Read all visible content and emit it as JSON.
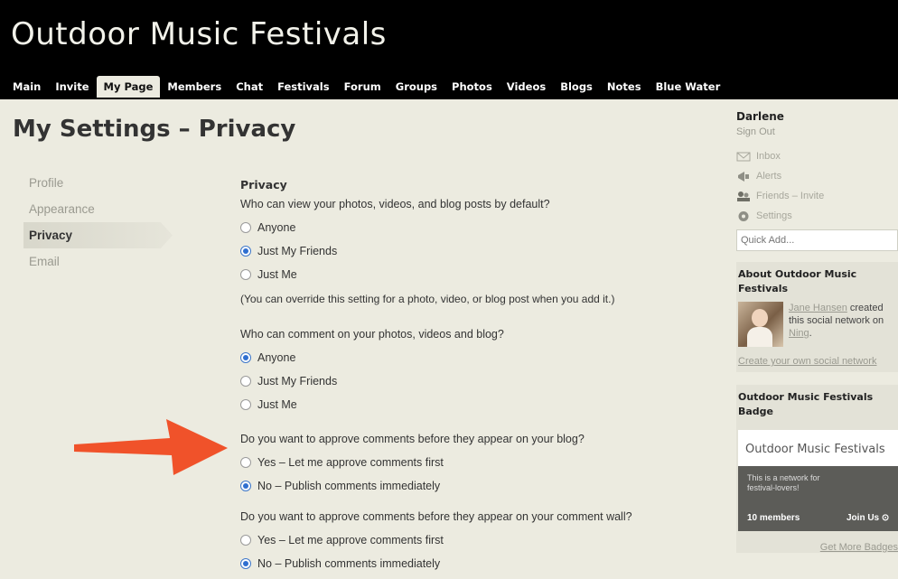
{
  "header": {
    "site_title": "Outdoor Music Festivals",
    "nav": [
      "Main",
      "Invite",
      "My Page",
      "Members",
      "Chat",
      "Festivals",
      "Forum",
      "Groups",
      "Photos",
      "Videos",
      "Blogs",
      "Notes",
      "Blue Water"
    ],
    "active_nav": "My Page"
  },
  "page_title": "My Settings – Privacy",
  "settings_menu": {
    "items": [
      "Profile",
      "Appearance",
      "Privacy",
      "Email"
    ],
    "active": "Privacy"
  },
  "privacy": {
    "section_title": "Privacy",
    "q1": {
      "question": "Who can view your photos, videos, and blog posts by default?",
      "options": [
        "Anyone",
        "Just My Friends",
        "Just Me"
      ],
      "selected": "Just My Friends",
      "note": "(You can override this setting for a photo, video, or blog post when you add it.)"
    },
    "q2": {
      "question": "Who can comment on your photos, videos and blog?",
      "options": [
        "Anyone",
        "Just My Friends",
        "Just Me"
      ],
      "selected": "Anyone"
    },
    "q3": {
      "question": "Do you want to approve comments before they appear on your blog?",
      "options": [
        "Yes – Let me approve comments first",
        "No – Publish comments immediately"
      ],
      "selected": "No – Publish comments immediately"
    },
    "q4": {
      "question": "Do you want to approve comments before they appear on your comment wall?",
      "options": [
        "Yes – Let me approve comments first",
        "No – Publish comments immediately"
      ],
      "selected": "No – Publish comments immediately"
    }
  },
  "annotation": {
    "arrow_color": "#f0522a"
  },
  "sidebar": {
    "user_name": "Darlene",
    "sign_out": "Sign Out",
    "links": {
      "inbox": "Inbox",
      "alerts": "Alerts",
      "friends": "Friends – Invite",
      "settings": "Settings"
    },
    "quick_add_placeholder": "Quick Add...",
    "about_title": "About Outdoor Music Festivals",
    "creator_name": "Jane Hansen",
    "creator_text": "created this social network on",
    "platform": "Ning",
    "create_link": "Create your own social network",
    "badge_title": "Outdoor Music Festivals Badge",
    "badge_name": "Outdoor Music Festivals",
    "badge_desc": "This is a network for festival-lovers!",
    "badge_members": "10 members",
    "badge_join": "Join Us",
    "more_badges": "Get More Badges"
  },
  "colors": {
    "background": "#ecebe0",
    "header": "#000000",
    "radio_checked": "#2f6fd0",
    "muted_text": "#9a9a90"
  }
}
